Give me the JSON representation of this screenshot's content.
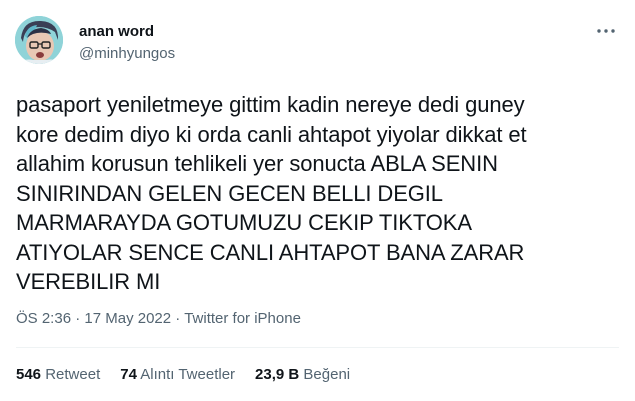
{
  "tweet": {
    "display_name": "anan word",
    "handle": "@minhyungos",
    "text": "pasaport yeniletmeye gittim kadin nereye dedi guney\nkore dedim diyo ki orda canli ahtapot yiyolar dikkat et\nallahim korusun tehlikeli yer sonucta ABLA SENIN\nSINIRINDAN GELEN GECEN BELLI DEGIL\nMARMARAYDA GOTUMUZU CEKIP TIKTOKA\nATIYOLAR SENCE CANLI AHTAPOT BANA ZARAR\nVEREBILIR MI",
    "time": "ÖS 2:36",
    "separator": " · ",
    "date": "17 May 2022",
    "source": "Twitter for iPhone"
  },
  "stats": {
    "retweets_count": "546",
    "retweets_label": "Retweet",
    "quotes_count": "74",
    "quotes_label": "Alıntı Tweetler",
    "likes_count": "23,9 B",
    "likes_label": "Beğeni"
  },
  "icons": {
    "more": "more-options-icon",
    "avatar": "avatar-image"
  },
  "colors": {
    "text_primary": "#0f1419",
    "text_secondary": "#536471",
    "divider": "#eff3f4"
  }
}
